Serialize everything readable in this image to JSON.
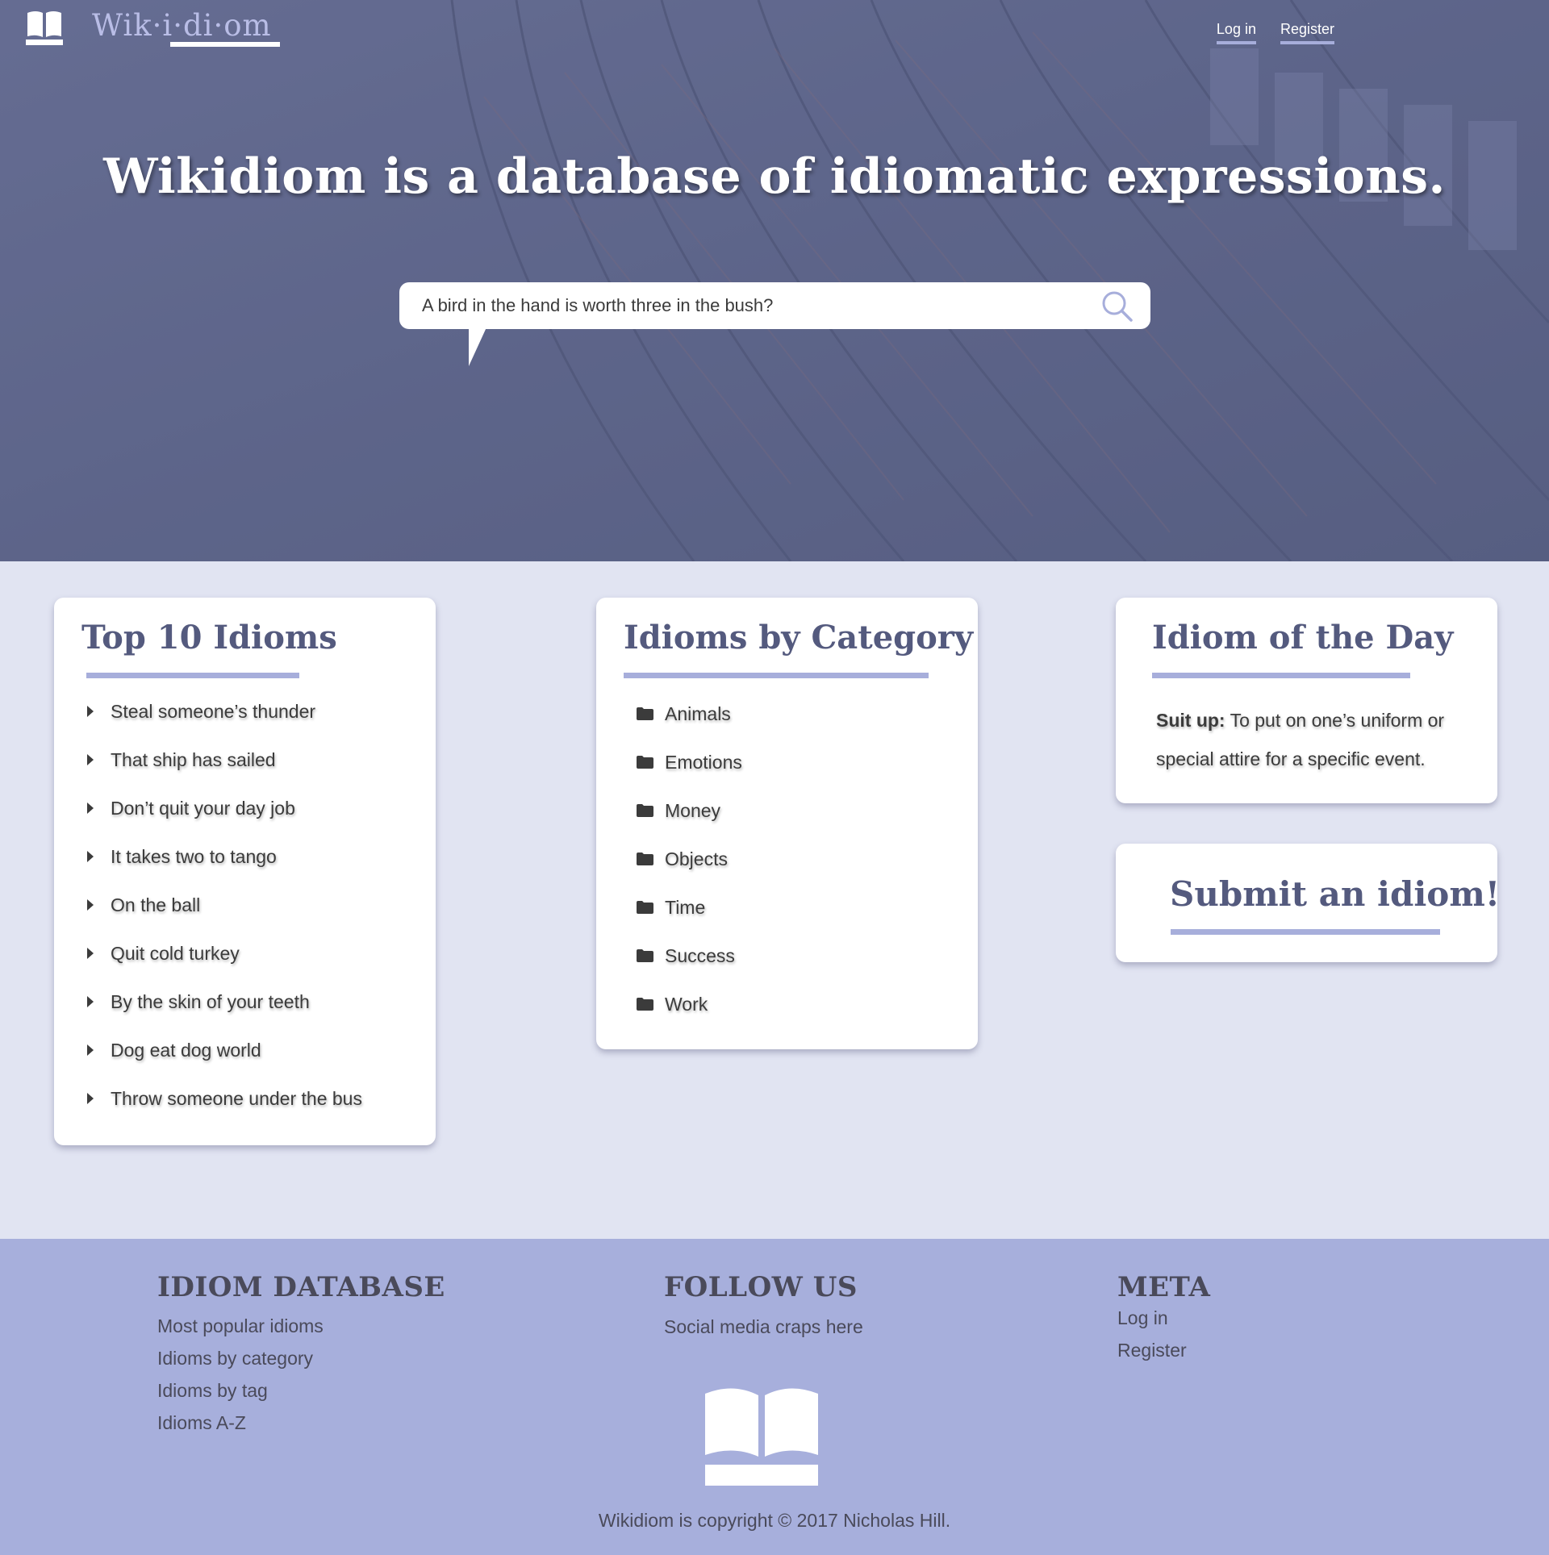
{
  "header": {
    "logo_text": "Wik·i·di·om",
    "nav": {
      "login": "Log in",
      "register": "Register"
    }
  },
  "hero": {
    "title": "Wikidiom is a database of idiomatic expressions.",
    "search_placeholder": "A bird in the hand is worth three in the bush?"
  },
  "top_idioms": {
    "title": "Top 10 Idioms",
    "items": [
      "Steal someone’s thunder",
      "That ship has sailed",
      "Don’t quit your day job",
      "It takes two to tango",
      "On the ball",
      "Quit cold turkey",
      "By the skin of your teeth",
      "Dog eat dog world",
      "Throw someone under the bus"
    ]
  },
  "categories": {
    "title": "Idioms by Category",
    "items": [
      "Animals",
      "Emotions",
      "Money",
      "Objects",
      "Time",
      "Success",
      "Work"
    ]
  },
  "idiom_of_day": {
    "title": "Idiom of the Day",
    "term": "Suit up:",
    "definition": " To put on one’s uniform or special attire for a specific event."
  },
  "submit": {
    "label": "Submit an idiom!"
  },
  "footer": {
    "database": {
      "heading": "IDIOM DATABASE",
      "links": [
        "Most popular idioms",
        "Idioms by category",
        "Idioms by tag",
        "Idioms A-Z"
      ]
    },
    "follow": {
      "heading": "FOLLOW US",
      "text": "Social media craps here"
    },
    "meta": {
      "heading": "META",
      "links": [
        "Log in",
        "Register"
      ]
    },
    "copyright": "Wikidiom is copyright © 2017 Nicholas Hill."
  },
  "colors": {
    "hero_bg": "#5d6486",
    "page_bg": "#e1e4f2",
    "accent": "#a7aedb",
    "card_title": "#545a7e",
    "footer_bg": "#a7afdc"
  }
}
